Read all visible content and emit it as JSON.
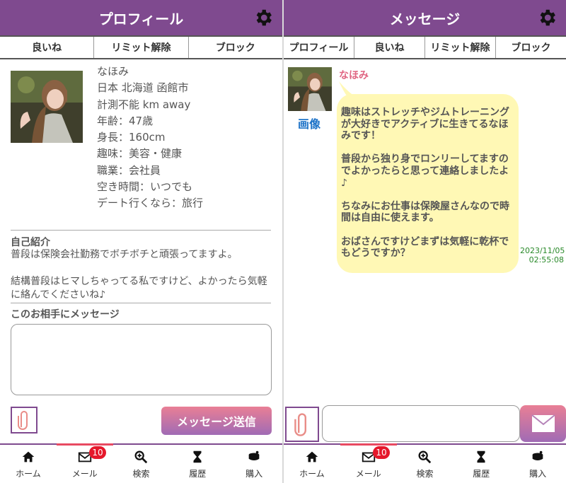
{
  "left": {
    "header_title": "プロフィール",
    "tabs": [
      "良いね",
      "リミット解除",
      "ブロック"
    ],
    "profile": {
      "name": "なほみ",
      "location": "日本 北海道 函館市",
      "distance": "計測不能 km away",
      "age": "年齢：47歳",
      "height": "身長：160cm",
      "hobby": "趣味：美容・健康",
      "job": "職業：会社員",
      "free_time": "空き時間：いつでも",
      "date_place": "デート行くなら：旅行"
    },
    "intro_title": "自己紹介",
    "intro_text": "普段は保険会社勤務でボチボチと頑張ってますよ。\n\n結構普段はヒマしちゃってる私ですけど、よかったら気軽に絡んでくださいね♪",
    "message_title": "このお相手にメッセージ",
    "send_label": "メッセージ送信"
  },
  "right": {
    "header_title": "メッセージ",
    "tabs": [
      "プロフィール",
      "良いね",
      "リミット解除",
      "ブロック"
    ],
    "sender": "なほみ",
    "image_label": "画像",
    "message": "趣味はストレッチやジムトレーニングが大好きでアクティブに生きてるなほみです！\n\n普段から独り身でロンリーしてますのでよかったらと思って連絡しましたよ♪\n\nちなみにお仕事は保険屋さんなので時間は自由に使えます。\n\nおばさんですけどまずは気軽に乾杯でもどうですか？",
    "timestamp_date": "2023/11/05",
    "timestamp_time": "02:55:08"
  },
  "nav": {
    "items": [
      {
        "label": "ホーム",
        "icon": "home-icon"
      },
      {
        "label": "メール",
        "icon": "mail-icon"
      },
      {
        "label": "検索",
        "icon": "search-icon"
      },
      {
        "label": "履歴",
        "icon": "hourglass-icon"
      },
      {
        "label": "購入",
        "icon": "coins-icon"
      }
    ],
    "mail_badge": "10"
  },
  "colors": {
    "header": "#7f4a8f",
    "accent_pink": "#e97f95",
    "bubble": "#fff8b5",
    "badge": "#e5182b"
  }
}
